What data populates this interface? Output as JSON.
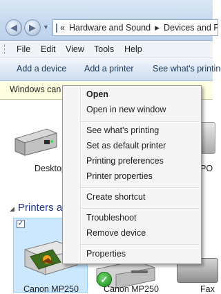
{
  "address": {
    "separator": "«",
    "crumbs": [
      "Hardware and Sound",
      "Devices and Printers"
    ]
  },
  "menu": {
    "items": [
      {
        "label": "File"
      },
      {
        "label": "Edit"
      },
      {
        "label": "View"
      },
      {
        "label": "Tools"
      },
      {
        "label": "Help"
      }
    ]
  },
  "commands": {
    "add_device": "Add a device",
    "add_printer": "Add a printer",
    "see_printing": "See what's printing"
  },
  "infobar": {
    "text": "Windows can enable network discovery and form"
  },
  "devices": {
    "desktop_label": "Desktop",
    "right_partial_label": "PO"
  },
  "printers_group": {
    "title": "Printers and Faxes",
    "items": [
      {
        "label": "Canon MP250",
        "selected": true,
        "checked": "✓"
      },
      {
        "label": "Canon MP250",
        "default": true
      },
      {
        "label": "Fax"
      }
    ]
  },
  "context_menu": {
    "items": [
      {
        "label": "Open",
        "bold": true
      },
      {
        "label": "Open in new window"
      },
      {
        "label": "See what's printing"
      },
      {
        "label": "Set as default printer"
      },
      {
        "label": "Printing preferences"
      },
      {
        "label": "Printer properties"
      },
      {
        "label": "Create shortcut"
      },
      {
        "label": "Troubleshoot"
      },
      {
        "label": "Remove device"
      },
      {
        "label": "Properties"
      }
    ]
  },
  "icons": {
    "back": "back-arrow-icon",
    "forward": "forward-arrow-icon",
    "recent": "chevron-down-icon",
    "address": "control-panel-icon",
    "group_toggle": "collapse-triangle-icon",
    "default_badge": "green-check-icon"
  },
  "colors": {
    "selection": "#cce8ff",
    "group_title": "#1e3287",
    "infobar": "#ffffe1",
    "command_text": "#1e395b"
  }
}
